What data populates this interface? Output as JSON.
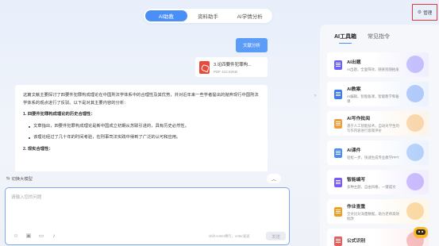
{
  "top_tabs": [
    {
      "label": "AI助教",
      "active": true
    },
    {
      "label": "资料助手",
      "active": false
    },
    {
      "label": "AI学情分析",
      "active": false
    }
  ],
  "manage": {
    "label": "管理",
    "icon": "gear-icon"
  },
  "chat": {
    "user_message": "文献分析",
    "file": {
      "name": "3.论四要件犯罪构...",
      "size": "PDF 412.92KB",
      "icon": "pdf-file-icon"
    },
    "answer": {
      "intro": "这篇文献主要探讨了四要件犯罪构成理论在中国刑法学体系中的合理性及其优势，并对近年来一些学者提出的抛弃现行中国刑法学体系的观点进行了反驳。以下是对其主要内容的分析：",
      "section1_title": "1. 四要件犯罪构成理论的历史合理性：",
      "section1_items": [
        "文章指出，四要件犯罪构成理论是新中国成立初期从苏联引进的，具有历史必然性。",
        "该理论经过了几十年的时间考验，在刑事司法实践中得到了广泛的认可和应用。"
      ],
      "section2_title": "2. 现实合理性："
    },
    "collapse_icon": "chevron-up-icon"
  },
  "model_switch": {
    "label": "切换大模型",
    "icon": "switch-icon"
  },
  "input": {
    "placeholder": "请输入您的问题",
    "value": "",
    "hint": "shift+enter换行，enter发送",
    "send_label": "发送",
    "tools": [
      "emoji-icon",
      "image-icon",
      "folder-icon",
      "microphone-icon"
    ]
  },
  "sidebar": {
    "collapse_icon": "chevron-right-icon",
    "tabs": [
      {
        "label": "AI工具箱",
        "active": true
      },
      {
        "label": "常见指令",
        "active": false
      }
    ],
    "tools": [
      {
        "name": "AI出题",
        "desc": "AI出题，全面筛效，随查别随拍发",
        "color": "#6c63ff",
        "tint": "#efeefe"
      },
      {
        "name": "AI教案",
        "desc": "AI编辑，智能备课，智能教学和备课",
        "color": "#3d7bf6",
        "tint": "#ebf2fe"
      },
      {
        "name": "AI写作批阅",
        "desc": "基于人工智能技术，自动对学生的写作内容进行客观评价",
        "color": "#f29d38",
        "tint": "#fdf3e7"
      },
      {
        "name": "AI课件",
        "desc": "轻松一步，快速生成专业教学PPT",
        "color": "#4a8ff7",
        "tint": "#ecf3fe"
      },
      {
        "name": "智能编写",
        "desc": "多种主题，自由风格，一键成文",
        "color": "#7a5af8",
        "tint": "#f1edfe"
      },
      {
        "name": "作业查重",
        "desc": "全文比对海量数据，助力老师高效批改",
        "color": "#f0a020",
        "tint": "#fef6e6"
      },
      {
        "name": "公式识别",
        "desc": "",
        "color": "#e85d5d",
        "tint": "#fdeeee"
      }
    ]
  },
  "assistant": {
    "icon": "robot-assistant-icon"
  },
  "colors": {
    "accent": "#4a8ff7",
    "highlight_box": "#e53935",
    "pdf": "#e84b3c"
  }
}
